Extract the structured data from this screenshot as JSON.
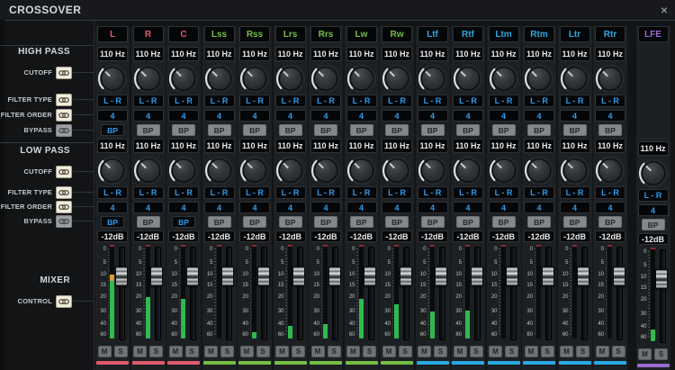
{
  "window": {
    "title": "CROSSOVER",
    "close_icon": "×"
  },
  "colors": {
    "accent": "#2d9cf0",
    "meter_green": "#2fba50",
    "meter_orange": "#dd9e2f",
    "groups": {
      "red": "#e05a6e",
      "green": "#72bf44",
      "blue": "#29a9e1",
      "purple": "#9a6ad0"
    }
  },
  "sidebar": {
    "sections": [
      {
        "label": "HIGH PASS",
        "rows": [
          {
            "label": "CUTOFF",
            "linked": true
          },
          {
            "label": "FILTER TYPE",
            "linked": true
          },
          {
            "label": "FILTER ORDER",
            "linked": true
          },
          {
            "label": "BYPASS",
            "linked": false
          }
        ]
      },
      {
        "label": "LOW PASS",
        "rows": [
          {
            "label": "CUTOFF",
            "linked": true
          },
          {
            "label": "FILTER TYPE",
            "linked": true
          },
          {
            "label": "FILTER ORDER",
            "linked": true
          },
          {
            "label": "BYPASS",
            "linked": false
          }
        ]
      },
      {
        "label": "MIXER",
        "rows": [
          {
            "label": "CONTROL",
            "linked": true
          }
        ]
      }
    ]
  },
  "strip_defaults": {
    "cutoff": "110 Hz",
    "filter_type": "L - R",
    "filter_order": "4",
    "bypass": "BP",
    "gain": "-12dB",
    "mute": "M",
    "solo": "S",
    "scale_ticks": [
      "0",
      "5",
      "10",
      "15",
      "20",
      "30",
      "40",
      "60"
    ]
  },
  "channels": [
    {
      "name": "L",
      "group": "red",
      "has_hp": true,
      "hp_bypass_engaged": true,
      "lp_bypass_engaged": true,
      "meter_green_pct": 63,
      "meter_orange_pct": 7
    },
    {
      "name": "R",
      "group": "red",
      "has_hp": true,
      "hp_bypass_engaged": false,
      "lp_bypass_engaged": false,
      "meter_green_pct": 45,
      "meter_orange_pct": 0
    },
    {
      "name": "C",
      "group": "red",
      "has_hp": true,
      "hp_bypass_engaged": false,
      "lp_bypass_engaged": true,
      "meter_green_pct": 43,
      "meter_orange_pct": 0
    },
    {
      "name": "Lss",
      "group": "green",
      "has_hp": true,
      "hp_bypass_engaged": false,
      "lp_bypass_engaged": false,
      "meter_green_pct": 0,
      "meter_orange_pct": 0
    },
    {
      "name": "Rss",
      "group": "green",
      "has_hp": true,
      "hp_bypass_engaged": false,
      "lp_bypass_engaged": false,
      "meter_green_pct": 7,
      "meter_orange_pct": 0
    },
    {
      "name": "Lrs",
      "group": "green",
      "has_hp": true,
      "hp_bypass_engaged": false,
      "lp_bypass_engaged": false,
      "meter_green_pct": 14,
      "meter_orange_pct": 0
    },
    {
      "name": "Rrs",
      "group": "green",
      "has_hp": true,
      "hp_bypass_engaged": false,
      "lp_bypass_engaged": false,
      "meter_green_pct": 16,
      "meter_orange_pct": 0
    },
    {
      "name": "Lw",
      "group": "green",
      "has_hp": true,
      "hp_bypass_engaged": false,
      "lp_bypass_engaged": false,
      "meter_green_pct": 43,
      "meter_orange_pct": 0
    },
    {
      "name": "Rw",
      "group": "green",
      "has_hp": true,
      "hp_bypass_engaged": false,
      "lp_bypass_engaged": false,
      "meter_green_pct": 37,
      "meter_orange_pct": 0
    },
    {
      "name": "Ltf",
      "group": "blue",
      "has_hp": true,
      "hp_bypass_engaged": false,
      "lp_bypass_engaged": false,
      "meter_green_pct": 29,
      "meter_orange_pct": 0
    },
    {
      "name": "Rtf",
      "group": "blue",
      "has_hp": true,
      "hp_bypass_engaged": false,
      "lp_bypass_engaged": false,
      "meter_green_pct": 30,
      "meter_orange_pct": 0
    },
    {
      "name": "Ltm",
      "group": "blue",
      "has_hp": true,
      "hp_bypass_engaged": false,
      "lp_bypass_engaged": false,
      "meter_green_pct": 0,
      "meter_orange_pct": 0
    },
    {
      "name": "Rtm",
      "group": "blue",
      "has_hp": true,
      "hp_bypass_engaged": false,
      "lp_bypass_engaged": false,
      "meter_green_pct": 0,
      "meter_orange_pct": 0
    },
    {
      "name": "Ltr",
      "group": "blue",
      "has_hp": true,
      "hp_bypass_engaged": false,
      "lp_bypass_engaged": false,
      "meter_green_pct": 0,
      "meter_orange_pct": 0
    },
    {
      "name": "Rtr",
      "group": "blue",
      "has_hp": true,
      "hp_bypass_engaged": false,
      "lp_bypass_engaged": false,
      "meter_green_pct": 0,
      "meter_orange_pct": 0
    },
    {
      "name": "LFE",
      "group": "purple",
      "has_hp": false,
      "hp_bypass_engaged": false,
      "lp_bypass_engaged": false,
      "meter_green_pct": 13,
      "meter_orange_pct": 0
    }
  ]
}
